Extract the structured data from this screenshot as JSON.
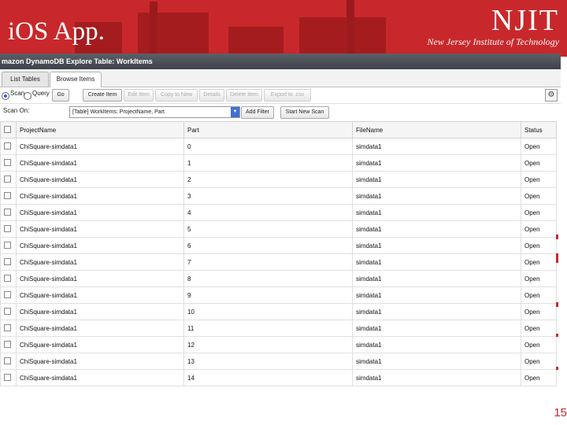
{
  "slide": {
    "title": "iOS App.",
    "page_number": "15"
  },
  "logo": {
    "name": "NJIT",
    "subtitle": "New Jersey Institute of Technology"
  },
  "console": {
    "window_title": "mazon DynamoDB Explore Table: WorkItems",
    "tabs": [
      {
        "label": "List Tables",
        "active": false
      },
      {
        "label": "Browse Items",
        "active": true
      }
    ],
    "toolbar": {
      "scan_label": "Scan",
      "query_label": "Query",
      "selected_mode": "Scan",
      "go": "Go",
      "create_item": "Create Item",
      "edit_item": "Edit Item",
      "copy_to_new": "Copy to New",
      "details": "Details",
      "delete_item": "Delete Item",
      "export_csv": "Export to .csv"
    },
    "scan_on": {
      "label": "Scan On:",
      "value": "[Table] WorkItems: ProjectName, Part",
      "add_filter": "Add Filter",
      "start_new_scan": "Start New Scan"
    },
    "table": {
      "columns": [
        "ProjectName",
        "Part",
        "FileName",
        "Status"
      ],
      "rows": [
        [
          "ChiSquare-simdata1",
          "0",
          "simdata1",
          "Open"
        ],
        [
          "ChiSquare-simdata1",
          "1",
          "simdata1",
          "Open"
        ],
        [
          "ChiSquare-simdata1",
          "2",
          "simdata1",
          "Open"
        ],
        [
          "ChiSquare-simdata1",
          "3",
          "simdata1",
          "Open"
        ],
        [
          "ChiSquare-simdata1",
          "4",
          "simdata1",
          "Open"
        ],
        [
          "ChiSquare-simdata1",
          "5",
          "simdata1",
          "Open"
        ],
        [
          "ChiSquare-simdata1",
          "6",
          "simdata1",
          "Open"
        ],
        [
          "ChiSquare-simdata1",
          "7",
          "simdata1",
          "Open"
        ],
        [
          "ChiSquare-simdata1",
          "8",
          "simdata1",
          "Open"
        ],
        [
          "ChiSquare-simdata1",
          "9",
          "simdata1",
          "Open"
        ],
        [
          "ChiSquare-simdata1",
          "10",
          "simdata1",
          "Open"
        ],
        [
          "ChiSquare-simdata1",
          "11",
          "simdata1",
          "Open"
        ],
        [
          "ChiSquare-simdata1",
          "12",
          "simdata1",
          "Open"
        ],
        [
          "ChiSquare-simdata1",
          "13",
          "simdata1",
          "Open"
        ],
        [
          "ChiSquare-simdata1",
          "14",
          "simdata1",
          "Open"
        ]
      ]
    }
  },
  "colors": {
    "banner": "#c8282b",
    "titlebar": "#4a4e55",
    "accent": "#3f6fd6"
  }
}
